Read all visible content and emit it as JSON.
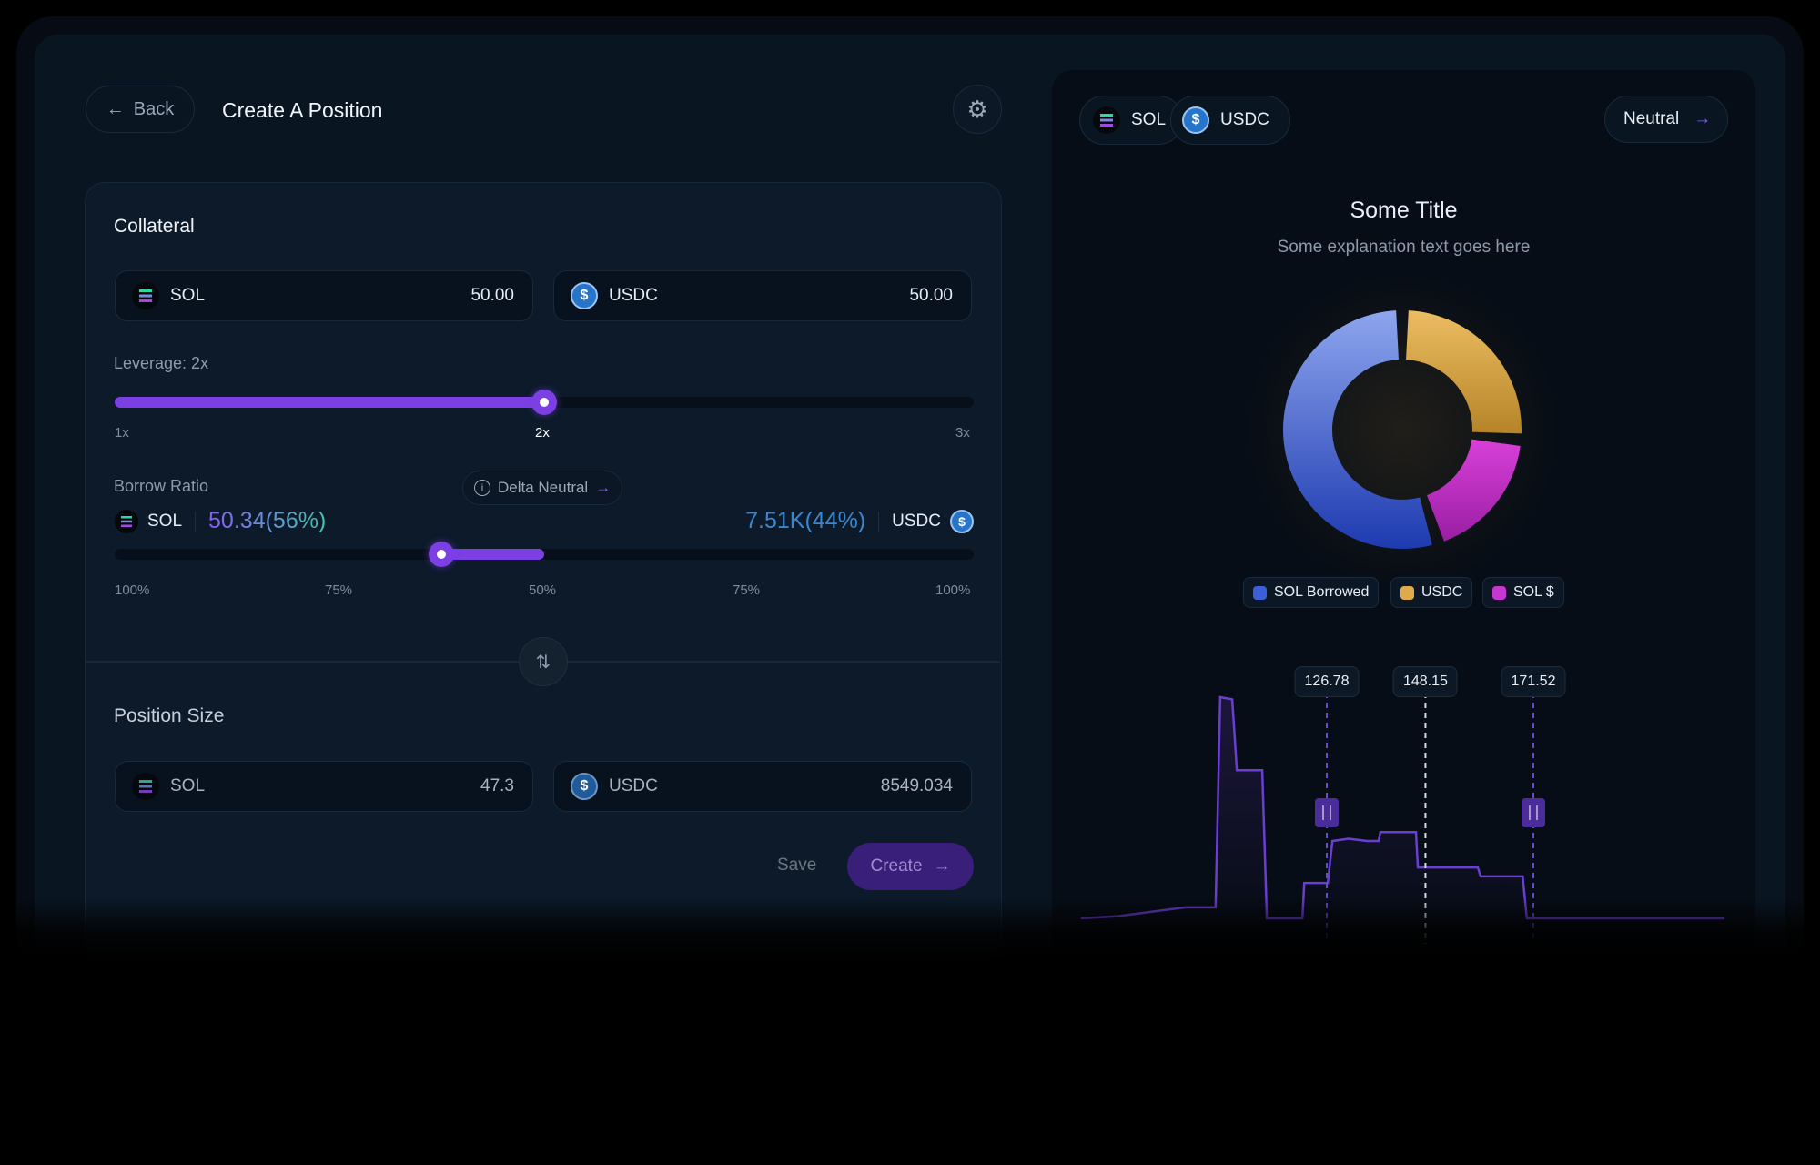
{
  "header": {
    "back_label": "Back",
    "title": "Create A Position",
    "settings_icon": "gear-icon"
  },
  "collateral": {
    "title": "Collateral",
    "inputs": [
      {
        "token": "SOL",
        "value": "50.00"
      },
      {
        "token": "USDC",
        "value": "50.00"
      }
    ]
  },
  "leverage": {
    "label": "Leverage: 2x",
    "value": 2,
    "min": 1,
    "max": 3,
    "ticks": [
      "1x",
      "2x",
      "3x"
    ]
  },
  "borrow": {
    "label": "Borrow Ratio",
    "delta_neutral_label": "Delta Neutral",
    "left_token": "SOL",
    "left_value": "50.34(56%)",
    "right_value": "7.51K(44%)",
    "right_token": "USDC",
    "ticks": [
      "100%",
      "75%",
      "50%",
      "75%",
      "100%"
    ],
    "range_fraction": [
      0.38,
      0.5
    ]
  },
  "position": {
    "title": "Position Size",
    "inputs": [
      {
        "token": "SOL",
        "value": "47.3"
      },
      {
        "token": "USDC",
        "value": "8549.034"
      }
    ]
  },
  "actions": {
    "save_label": "Save",
    "create_label": "Create"
  },
  "right": {
    "tokens": [
      "SOL",
      "USDC"
    ],
    "mode_label": "Neutral",
    "title": "Some Title",
    "subtitle": "Some explanation text goes here"
  },
  "colors": {
    "accent": "#7b3fe4",
    "sol_borrowed": "#3a5fd8",
    "usdc": "#e0a94a",
    "sol_dollar": "#c935cf",
    "usdc_value": "#3b86cf"
  },
  "chart_data": [
    {
      "type": "pie",
      "donut": true,
      "categories": [
        "SOL Borrowed",
        "USDC",
        "SOL $"
      ],
      "values": [
        56,
        26,
        18
      ]
    },
    {
      "type": "line",
      "step": true,
      "points": [
        [
          73.5,
          0
        ],
        [
          81.6,
          1
        ],
        [
          96.2,
          5
        ],
        [
          102.7,
          5
        ],
        [
          103.7,
          100
        ],
        [
          106.3,
          99
        ],
        [
          107.3,
          67
        ],
        [
          112.8,
          67
        ],
        [
          113.8,
          0
        ],
        [
          121.5,
          0
        ],
        [
          121.9,
          16
        ],
        [
          127.0,
          16
        ],
        [
          128.0,
          35
        ],
        [
          131.5,
          36
        ],
        [
          135.5,
          35
        ],
        [
          138.0,
          35
        ],
        [
          138.4,
          39
        ],
        [
          146.1,
          39
        ],
        [
          146.5,
          23
        ],
        [
          159.5,
          23
        ],
        [
          160.1,
          19
        ],
        [
          169.2,
          19
        ],
        [
          170.1,
          0
        ],
        [
          212.9,
          0
        ]
      ],
      "markers": [
        {
          "label": "126.78",
          "value": 126.78,
          "handle": true
        },
        {
          "label": "148.15",
          "value": 148.15,
          "current": true
        },
        {
          "label": "171.52",
          "value": 171.52,
          "handle": true
        }
      ]
    }
  ]
}
